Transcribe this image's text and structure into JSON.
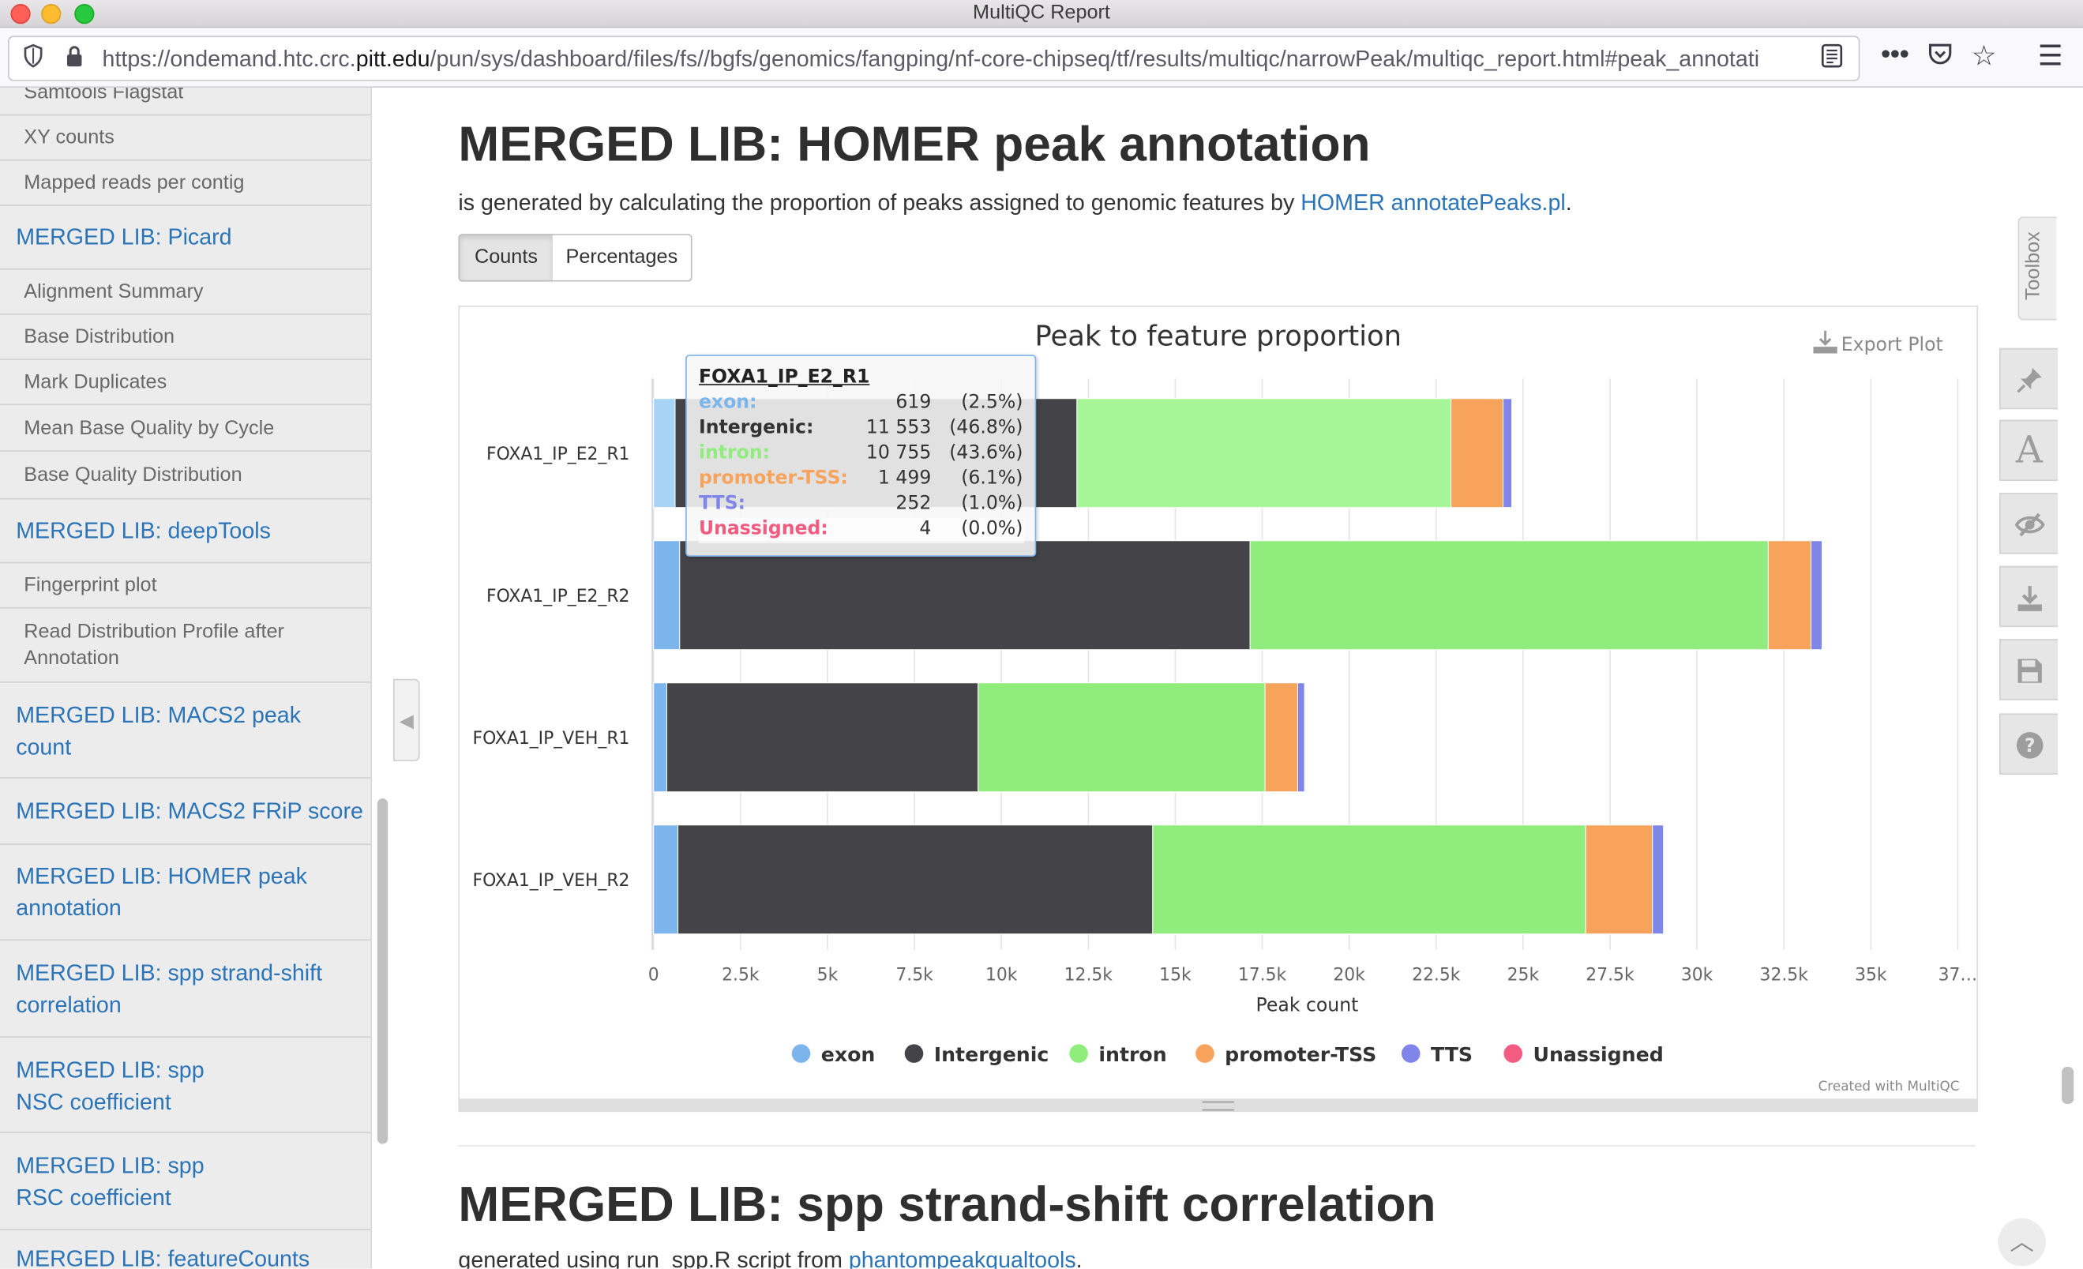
{
  "window": {
    "title": "MultiQC Report"
  },
  "browser": {
    "url_prefix": "https://ondemand.htc.crc.",
    "url_domain": "pitt.edu",
    "url_suffix": "/pun/sys/dashboard/files/fs//bgfs/genomics/fangping/nf-core-chipseq/tf/results/multiqc/narrowPeak/multiqc_report.html#peak_annotati"
  },
  "sidebar": {
    "items": [
      {
        "label": "Samtools Flagstat",
        "kind": "sub"
      },
      {
        "label": "XY counts",
        "kind": "sub"
      },
      {
        "label": "Mapped reads per contig",
        "kind": "sub"
      },
      {
        "label": "MERGED LIB: Picard",
        "kind": "main"
      },
      {
        "label": "Alignment Summary",
        "kind": "sub"
      },
      {
        "label": "Base Distribution",
        "kind": "sub"
      },
      {
        "label": "Mark Duplicates",
        "kind": "sub"
      },
      {
        "label": "Mean Base Quality by Cycle",
        "kind": "sub"
      },
      {
        "label": "Base Quality Distribution",
        "kind": "sub"
      },
      {
        "label": "MERGED LIB: deepTools",
        "kind": "main"
      },
      {
        "label": "Fingerprint plot",
        "kind": "sub"
      },
      {
        "label": "Read Distribution Profile after Annotation",
        "kind": "sub"
      },
      {
        "label": "MERGED LIB: MACS2 peak count",
        "kind": "main"
      },
      {
        "label": "MERGED LIB: MACS2 FRiP score",
        "kind": "main"
      },
      {
        "label": "MERGED LIB: HOMER peak annotation",
        "kind": "main"
      },
      {
        "label": "MERGED LIB: spp strand-shift correlation",
        "kind": "main"
      },
      {
        "label": "MERGED LIB: spp NSC coefficient",
        "kind": "main"
      },
      {
        "label": "MERGED LIB: spp RSC coefficient",
        "kind": "main"
      },
      {
        "label": "MERGED LIB: featureCounts",
        "kind": "main"
      }
    ]
  },
  "section": {
    "title": "MERGED LIB: HOMER peak annotation",
    "desc_prefix": "is generated by calculating the proportion of peaks assigned to genomic features by ",
    "desc_link": "HOMER annotatePeaks.pl",
    "desc_suffix": ".",
    "btn_counts": "Counts",
    "btn_percentages": "Percentages"
  },
  "plot": {
    "export_label": "Export Plot",
    "credit": "Created with MultiQC"
  },
  "chart_data": {
    "type": "bar",
    "orientation": "horizontal",
    "stacked": true,
    "title": "Peak to feature proportion",
    "xlabel": "Peak count",
    "ylabel": "",
    "xlim": [
      0,
      37500
    ],
    "x_tick_labels": [
      "0",
      "2.5k",
      "5k",
      "7.5k",
      "10k",
      "12.5k",
      "15k",
      "17.5k",
      "20k",
      "22.5k",
      "25k",
      "27.5k",
      "30k",
      "32.5k",
      "35k",
      "37…"
    ],
    "grid": true,
    "legend_position": "bottom",
    "categories": [
      "FOXA1_IP_E2_R1",
      "FOXA1_IP_E2_R2",
      "FOXA1_IP_VEH_R1",
      "FOXA1_IP_VEH_R2"
    ],
    "series": [
      {
        "name": "exon",
        "color": "#7cb5ec",
        "values": [
          619,
          750,
          380,
          700
        ]
      },
      {
        "name": "Intergenic",
        "color": "#434348",
        "values": [
          11553,
          16400,
          8950,
          13650
        ]
      },
      {
        "name": "intron",
        "color": "#90ed7d",
        "values": [
          10755,
          14900,
          8250,
          12450
        ]
      },
      {
        "name": "promoter-TSS",
        "color": "#f7a35c",
        "values": [
          1499,
          1230,
          940,
          1920
        ]
      },
      {
        "name": "TTS",
        "color": "#8085e9",
        "values": [
          252,
          320,
          200,
          320
        ]
      },
      {
        "name": "Unassigned",
        "color": "#f15c80",
        "values": [
          4,
          5,
          3,
          5
        ]
      }
    ]
  },
  "tooltip": {
    "title": "FOXA1_IP_E2_R1",
    "rows": [
      {
        "label": "exon:",
        "count": "619",
        "pct": "(2.5%)",
        "color": "#7cb5ec"
      },
      {
        "label": "Intergenic:",
        "count": "11 553",
        "pct": "(46.8%)",
        "color": "#333333"
      },
      {
        "label": "intron:",
        "count": "10 755",
        "pct": "(43.6%)",
        "color": "#90ed7d"
      },
      {
        "label": "promoter-TSS:",
        "count": "1 499",
        "pct": "(6.1%)",
        "color": "#f7a35c"
      },
      {
        "label": "TTS:",
        "count": "252",
        "pct": "(1.0%)",
        "color": "#8085e9"
      },
      {
        "label": "Unassigned:",
        "count": "4",
        "pct": "(0.0%)",
        "color": "#f15c80"
      }
    ]
  },
  "next_section": {
    "title": "MERGED LIB: spp strand-shift correlation",
    "desc_prefix": "generated using run_spp.R script from ",
    "desc_link": "phantompeakqualtools",
    "desc_suffix": "."
  },
  "toolbox": {
    "label": "Toolbox",
    "buttons": [
      {
        "icon": "pin-icon"
      },
      {
        "icon": "font-icon"
      },
      {
        "icon": "hide-icon"
      },
      {
        "icon": "download-icon"
      },
      {
        "icon": "save-icon"
      },
      {
        "icon": "help-icon"
      }
    ]
  }
}
